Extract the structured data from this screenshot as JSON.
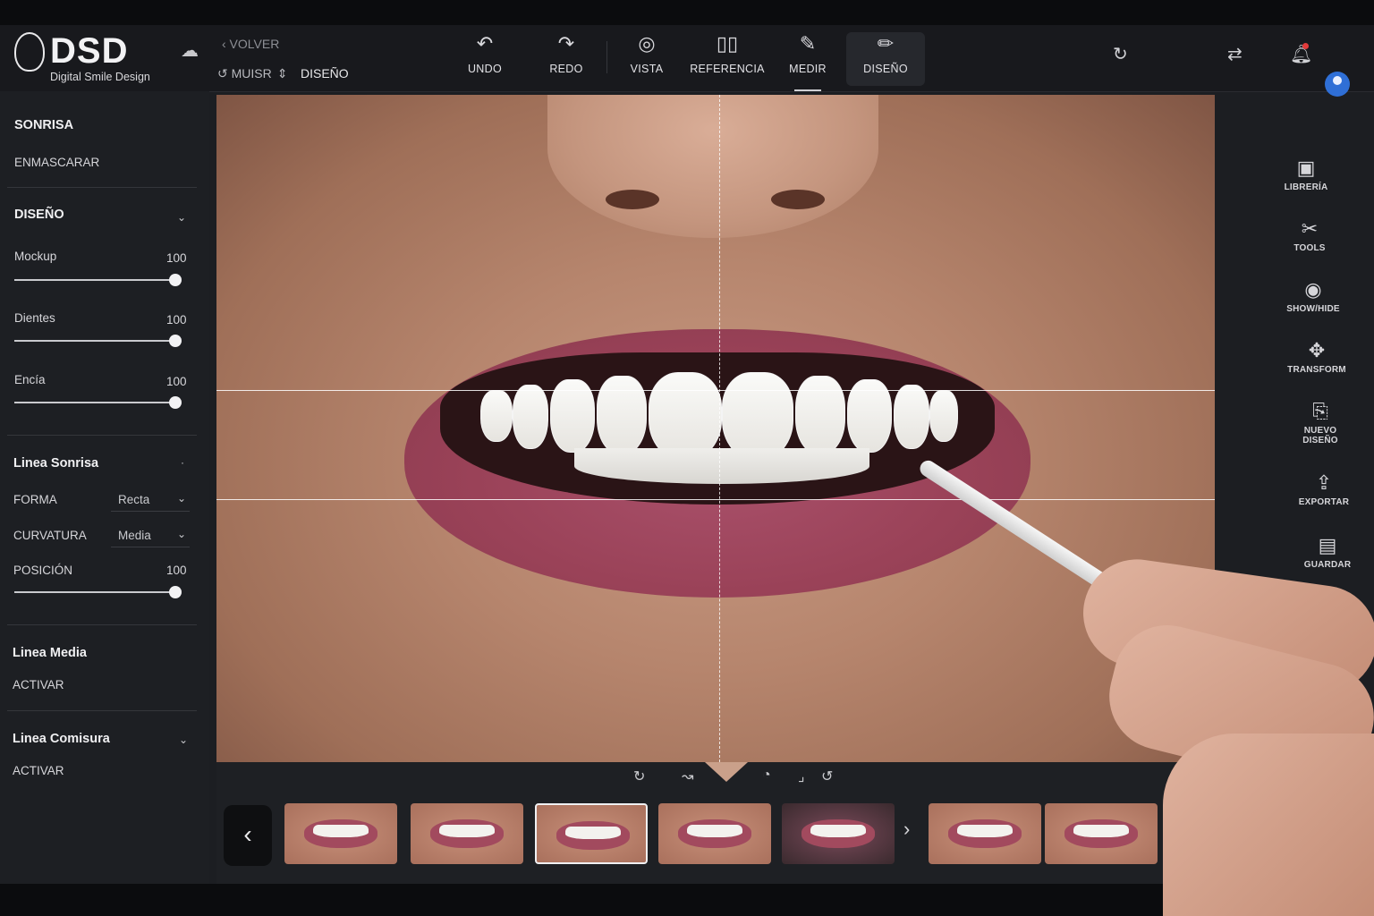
{
  "brand": {
    "logo_text": "DSD",
    "logo_sub": "Digital Smile Design"
  },
  "nav": {
    "back": "‹ VOLVER",
    "crumb_a": "MUISR",
    "crumb_current": "DISEÑO"
  },
  "toolbar": {
    "undo": "UNDO",
    "redo": "REDO",
    "vista": "VISTA",
    "referencia": "REFERENCIA",
    "medir": "MEDIR",
    "diseno": "DISEÑO",
    "active": "DISEÑO"
  },
  "sidebar": {
    "sonrisa": "SONRISA",
    "enmascarar": "ENMASCARAR",
    "diseno": "DISEÑO",
    "sliders": [
      {
        "label": "Mockup",
        "value": "100",
        "level": 1.0
      },
      {
        "label": "Dientes",
        "value": "100",
        "level": 1.0
      },
      {
        "label": "Encía",
        "value": "100",
        "level": 1.0
      }
    ],
    "linea_sonrisa": "Linea Sonrisa",
    "forma_label": "FORMA",
    "forma_value": "Recta",
    "curvatura_label": "CURVATURA",
    "curvatura_value": "Media",
    "posicion_label": "POSICIÓN",
    "posicion_value": "100",
    "posicion_level": 1.0,
    "linea_media": "Linea Media",
    "linea_media_action": "ACTIVAR",
    "linea_comisura": "Linea Comisura",
    "linea_comisura_action": "ACTIVAR"
  },
  "right_tools": [
    {
      "label": "LIBRERÍA",
      "icon": "library-icon"
    },
    {
      "label": "TOOLS",
      "icon": "tools-icon"
    },
    {
      "label": "SHOW/HIDE",
      "icon": "eye-icon"
    },
    {
      "label": "TRANSFORM",
      "icon": "move-icon"
    },
    {
      "label": "NUEVO DISEÑO",
      "icon": "new-design-icon"
    },
    {
      "label": "EXPORTAR",
      "icon": "export-icon"
    },
    {
      "label": "GUARDAR",
      "icon": "save-icon"
    }
  ],
  "thumbnails": {
    "count": 8,
    "selected_index": 2
  },
  "colors": {
    "accent_notification": "#e23b3b",
    "avatar": "#2f6fd6",
    "panel": "#1d1f23"
  }
}
